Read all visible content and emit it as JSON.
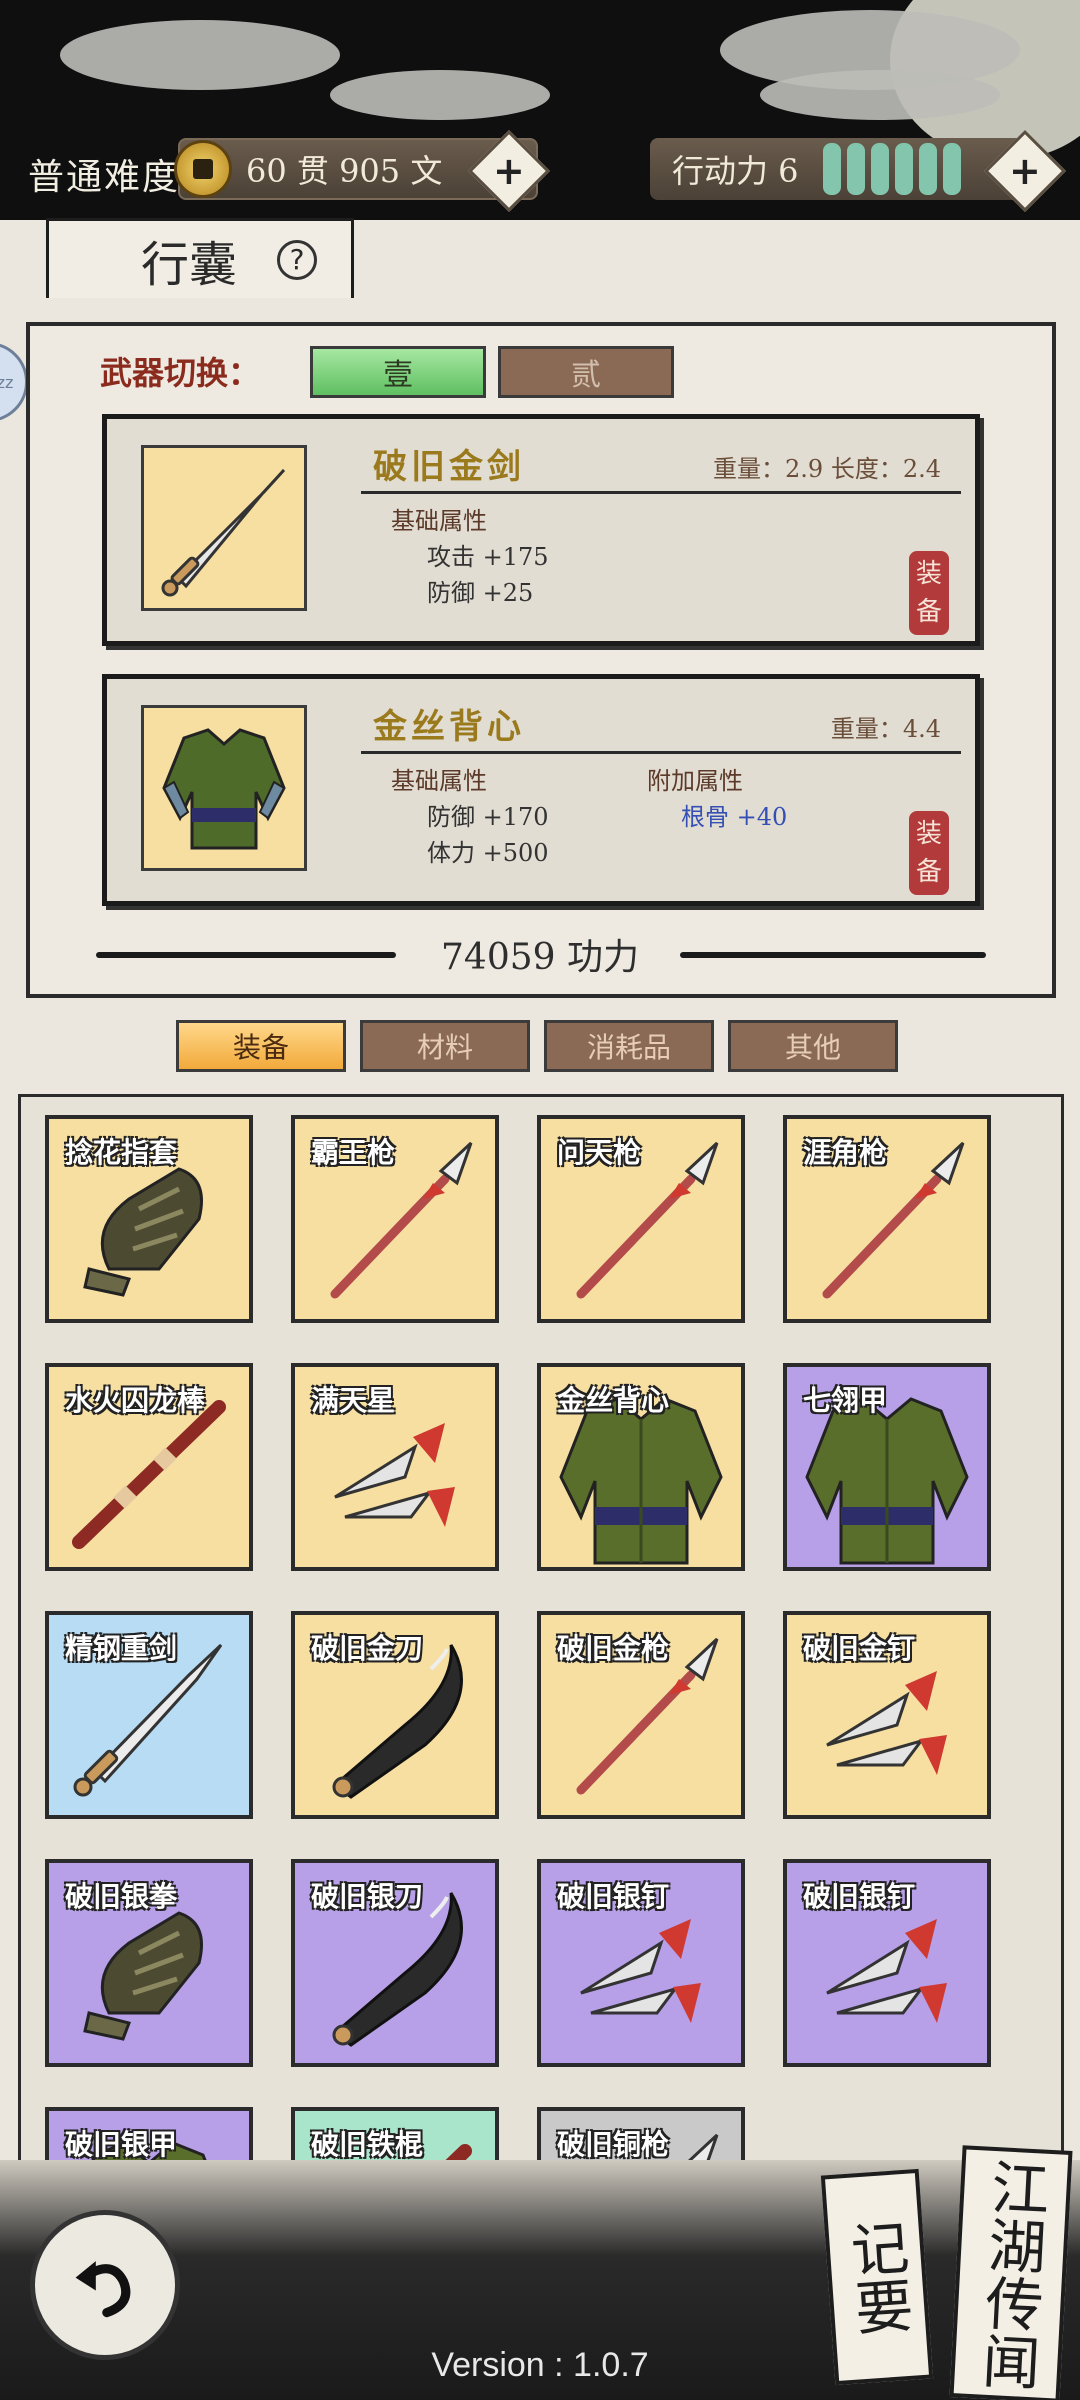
{
  "header": {
    "difficulty": "普通难度",
    "currency": "60 贯 905 文",
    "action_label": "行动力 6",
    "action_points": 6
  },
  "bag": {
    "title": "行囊",
    "help": "?",
    "side_tab": "zz"
  },
  "weapon_switch": {
    "label": "武器切换：",
    "slots": [
      "壹",
      "贰"
    ],
    "active": 0
  },
  "equipped": [
    {
      "name": "破旧金剑",
      "meta": "重量：2.9 长度：2.4",
      "base_label": "基础属性",
      "base_stats": [
        "攻击 +175",
        "防御 +25"
      ],
      "extra_label": "",
      "extra_stats": [],
      "action": "装备",
      "icon": "sword-icon"
    },
    {
      "name": "金丝背心",
      "meta": "重量：4.4",
      "base_label": "基础属性",
      "base_stats": [
        "防御 +170",
        "体力 +500"
      ],
      "extra_label": "附加属性",
      "extra_stats": [
        "根骨 +40"
      ],
      "action": "装备",
      "icon": "armor-icon"
    }
  ],
  "power": "74059 功力",
  "categories": [
    "装备",
    "材料",
    "消耗品",
    "其他"
  ],
  "active_category": 0,
  "items": [
    {
      "name": "捻花指套",
      "quality": "yellow",
      "icon": "gauntlet-icon"
    },
    {
      "name": "霸王枪",
      "quality": "yellow",
      "icon": "spear-icon"
    },
    {
      "name": "问天枪",
      "quality": "yellow",
      "icon": "spear-icon"
    },
    {
      "name": "涯角枪",
      "quality": "yellow",
      "icon": "spear-icon"
    },
    {
      "name": "水火囚龙棒",
      "quality": "yellow",
      "icon": "staff-icon"
    },
    {
      "name": "满天星",
      "quality": "yellow",
      "icon": "dart-icon"
    },
    {
      "name": "金丝背心",
      "quality": "yellow",
      "icon": "armor-icon"
    },
    {
      "name": "七翎甲",
      "quality": "purple",
      "icon": "armor-icon"
    },
    {
      "name": "精钢重剑",
      "quality": "blue",
      "icon": "sword-icon"
    },
    {
      "name": "破旧金刀",
      "quality": "yellow",
      "icon": "saber-icon"
    },
    {
      "name": "破旧金枪",
      "quality": "yellow",
      "icon": "spear-icon"
    },
    {
      "name": "破旧金钉",
      "quality": "yellow",
      "icon": "dart-icon"
    },
    {
      "name": "破旧银拳",
      "quality": "purple",
      "icon": "gauntlet-icon"
    },
    {
      "name": "破旧银刀",
      "quality": "purple",
      "icon": "saber-icon"
    },
    {
      "name": "破旧银钉",
      "quality": "purple",
      "icon": "dart-icon"
    },
    {
      "name": "破旧银钉",
      "quality": "purple",
      "icon": "dart-icon"
    },
    {
      "name": "破旧银甲",
      "quality": "purple",
      "icon": "armor-icon"
    },
    {
      "name": "破旧铁棍",
      "quality": "green",
      "icon": "staff-icon"
    },
    {
      "name": "破旧铜枪",
      "quality": "gray",
      "icon": "spear-icon"
    }
  ],
  "footer": {
    "notes": "记要",
    "rumors": "江湖传闻",
    "version": "Version : 1.0.7"
  }
}
